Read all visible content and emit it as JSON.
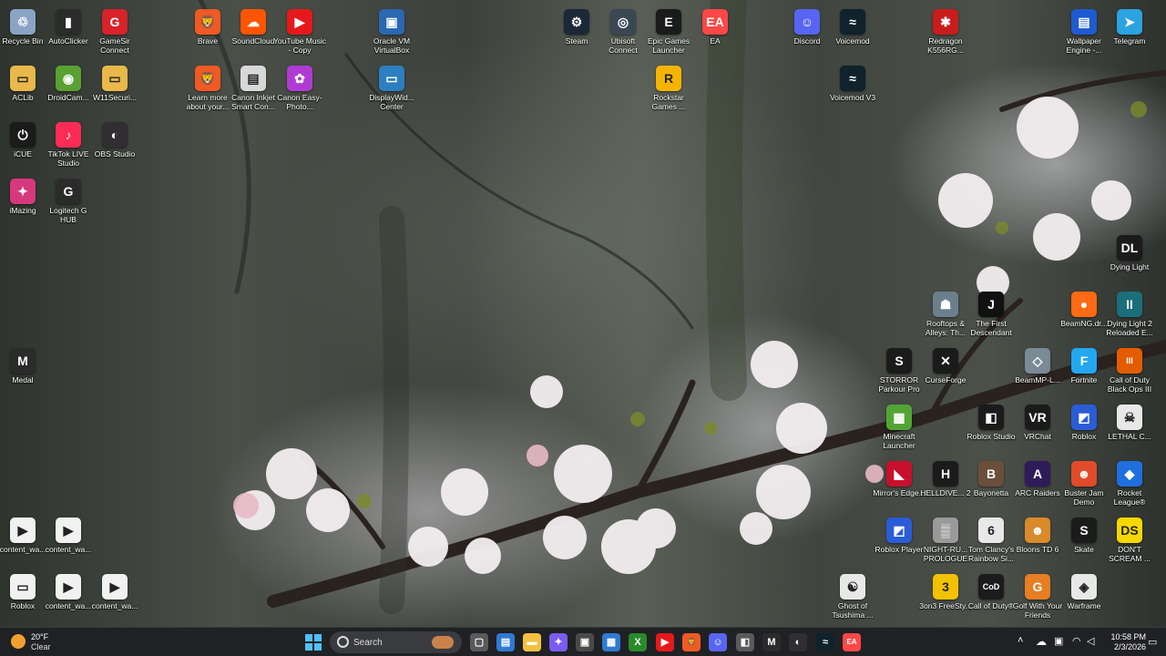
{
  "desktop_icons": [
    {
      "label": "Recycle Bin",
      "icon": "recycle-bin-icon",
      "color": "#8aa4c4",
      "glyph": "♲"
    },
    {
      "label": "AutoClicker",
      "icon": "mouse-icon",
      "color": "#2b2b2b",
      "glyph": "▮"
    },
    {
      "label": "GameSir Connect",
      "icon": "gamesir-icon",
      "color": "#d8232a",
      "glyph": "G"
    },
    {
      "label": "Brave",
      "icon": "brave-icon",
      "color": "#f05a24",
      "glyph": "🦁"
    },
    {
      "label": "SoundCloud",
      "icon": "soundcloud-icon",
      "color": "#ff5500",
      "glyph": "☁"
    },
    {
      "label": "YouTube Music - Copy",
      "icon": "youtube-music-icon",
      "color": "#e5191c",
      "glyph": "▶"
    },
    {
      "label": "Oracle VM VirtualBox",
      "icon": "virtualbox-icon",
      "color": "#2b68b1",
      "glyph": "▣"
    },
    {
      "label": "Steam",
      "icon": "steam-icon",
      "color": "#1b2838",
      "glyph": "⚙"
    },
    {
      "label": "Ubisoft Connect",
      "icon": "ubisoft-icon",
      "color": "#3b4754",
      "glyph": "◎"
    },
    {
      "label": "Epic Games Launcher",
      "icon": "epic-games-icon",
      "color": "#1b1b1b",
      "glyph": "E"
    },
    {
      "label": "EA",
      "icon": "ea-icon",
      "color": "#ff4747",
      "glyph": "EA"
    },
    {
      "label": "Discord",
      "icon": "discord-icon",
      "color": "#5865f2",
      "glyph": "☺"
    },
    {
      "label": "Voicemod",
      "icon": "voicemod-icon",
      "color": "#10222b",
      "glyph": "≈"
    },
    {
      "label": "Redragon K556RG...",
      "icon": "redragon-icon",
      "color": "#c91c1c",
      "glyph": "✱"
    },
    {
      "label": "Wallpaper Engine -...",
      "icon": "wallpaper-engine-icon",
      "color": "#1e5bd1",
      "glyph": "▤"
    },
    {
      "label": "Telegram",
      "icon": "telegram-icon",
      "color": "#2aa3e0",
      "glyph": "➤"
    },
    {
      "label": "ACLib",
      "icon": "folder-icon",
      "color": "#e8b84a",
      "glyph": "▭"
    },
    {
      "label": "DroidCam...",
      "icon": "droidcam-icon",
      "color": "#5aa133",
      "glyph": "◉"
    },
    {
      "label": "W11Securi...",
      "icon": "folder-icon",
      "color": "#e8b84a",
      "glyph": "▭"
    },
    {
      "label": "Learn more about your...",
      "icon": "brave-learn-icon",
      "color": "#f05a24",
      "glyph": "🦁"
    },
    {
      "label": "Canon Inkjet Smart Con...",
      "icon": "canon-printer-icon",
      "color": "#d8d8d8",
      "glyph": "▤"
    },
    {
      "label": "Canon Easy-Photo...",
      "icon": "canon-photo-icon",
      "color": "#b03bd3",
      "glyph": "✿"
    },
    {
      "label": "DisplayWid... Center",
      "icon": "displaywidget-icon",
      "color": "#2d7fc1",
      "glyph": "▭"
    },
    {
      "label": "Rockstar Games ...",
      "icon": "rockstar-icon",
      "color": "#f4b400",
      "glyph": "R"
    },
    {
      "label": "Voicemod V3",
      "icon": "voicemod-icon",
      "color": "#10222b",
      "glyph": "≈"
    },
    {
      "label": "iCUE",
      "icon": "icue-icon",
      "color": "#1b1b1b",
      "glyph": "⏻"
    },
    {
      "label": "TikTok LIVE Studio",
      "icon": "tiktok-icon",
      "color": "#fe2c55",
      "glyph": "♪"
    },
    {
      "label": "OBS Studio",
      "icon": "obs-icon",
      "color": "#302e31",
      "glyph": "◐"
    },
    {
      "label": "iMazing",
      "icon": "imazing-icon",
      "color": "#d6387d",
      "glyph": "✦"
    },
    {
      "label": "Logitech G HUB",
      "icon": "logitech-icon",
      "color": "#2b2b2b",
      "glyph": "G"
    },
    {
      "label": "Dying Light",
      "icon": "dying-light-icon",
      "color": "#1b1b1b",
      "glyph": "DL"
    },
    {
      "label": "Rooftops & Alleys: Th...",
      "icon": "rooftops-icon",
      "color": "#6b7f8c",
      "glyph": "☗"
    },
    {
      "label": "The First Descendant",
      "icon": "first-descendant-icon",
      "color": "#111111",
      "glyph": "J"
    },
    {
      "label": "BeamNG.dr...",
      "icon": "beamng-icon",
      "color": "#ff6a13",
      "glyph": "●"
    },
    {
      "label": "Dying Light 2 Reloaded E...",
      "icon": "dying-light-2-icon",
      "color": "#1a6f7a",
      "glyph": "II"
    },
    {
      "label": "Medal",
      "icon": "medal-icon",
      "color": "#2b2b2b",
      "glyph": "M"
    },
    {
      "label": "STORROR Parkour Pro",
      "icon": "storror-icon",
      "color": "#1b1b1b",
      "glyph": "S"
    },
    {
      "label": "CurseForge",
      "icon": "curseforge-icon",
      "color": "#1b1b1b",
      "glyph": "✕"
    },
    {
      "label": "BeamMP-L...",
      "icon": "beammp-icon",
      "color": "#7a8a96",
      "glyph": "◇"
    },
    {
      "label": "Fortnite",
      "icon": "fortnite-icon",
      "color": "#22a7f0",
      "glyph": "F"
    },
    {
      "label": "Call of Duty Black Ops III",
      "icon": "bo3-icon",
      "color": "#e35d00",
      "glyph": "III"
    },
    {
      "label": "Minecraft Launcher",
      "icon": "minecraft-icon",
      "color": "#52a535",
      "glyph": "▦"
    },
    {
      "label": "Roblox Studio",
      "icon": "roblox-studio-icon",
      "color": "#1b1b1b",
      "glyph": "◧"
    },
    {
      "label": "VRChat",
      "icon": "vrchat-icon",
      "color": "#1b1b1b",
      "glyph": "VR"
    },
    {
      "label": "Roblox",
      "icon": "roblox-icon",
      "color": "#2a5cd6",
      "glyph": "◩"
    },
    {
      "label": "LETHAL C...",
      "icon": "lethal-company-icon",
      "color": "#e8e8e8",
      "glyph": "☠"
    },
    {
      "label": "Mirror's Edge...",
      "icon": "mirrors-edge-icon",
      "color": "#c8102e",
      "glyph": "◣"
    },
    {
      "label": "HELLDIVE... 2",
      "icon": "helldivers-icon",
      "color": "#1b1b1b",
      "glyph": "H"
    },
    {
      "label": "Bayonetta",
      "icon": "bayonetta-icon",
      "color": "#6b4f3a",
      "glyph": "B"
    },
    {
      "label": "ARC Raiders",
      "icon": "arc-raiders-icon",
      "color": "#2e1b5a",
      "glyph": "A"
    },
    {
      "label": "Buster Jam Demo",
      "icon": "buster-jam-icon",
      "color": "#e14b2a",
      "glyph": "☻"
    },
    {
      "label": "Rocket League®",
      "icon": "rocket-league-icon",
      "color": "#1f6fe0",
      "glyph": "◆"
    },
    {
      "label": "content_wa...",
      "icon": "media-file-icon",
      "color": "#f1f1f1",
      "glyph": "▶"
    },
    {
      "label": "content_wa...",
      "icon": "media-file-icon",
      "color": "#f1f1f1",
      "glyph": "▶"
    },
    {
      "label": "Roblox Player",
      "icon": "roblox-player-icon",
      "color": "#2a5cd6",
      "glyph": "◩"
    },
    {
      "label": "NIGHT-RU... PROLOGUE",
      "icon": "night-runners-icon",
      "color": "#9a9a9a",
      "glyph": "▒"
    },
    {
      "label": "Tom Clancy's Rainbow Si...",
      "icon": "rainbow-six-icon",
      "color": "#e8e8e8",
      "glyph": "6"
    },
    {
      "label": "Bloons TD 6",
      "icon": "bloons-icon",
      "color": "#d98a2b",
      "glyph": "☻"
    },
    {
      "label": "Skate",
      "icon": "skate-icon",
      "color": "#1b1b1b",
      "glyph": "S"
    },
    {
      "label": "DON'T SCREAM ...",
      "icon": "dont-scream-icon",
      "color": "#f5d800",
      "glyph": "DS"
    },
    {
      "label": "Roblox",
      "icon": "roblox-file-icon",
      "color": "#f1f1f1",
      "glyph": "▭"
    },
    {
      "label": "content_wa...",
      "icon": "media-file-icon",
      "color": "#f1f1f1",
      "glyph": "▶"
    },
    {
      "label": "content_wa...",
      "icon": "media-file-icon",
      "color": "#f1f1f1",
      "glyph": "▶"
    },
    {
      "label": "Ghost of Tsushima ...",
      "icon": "ghost-of-tsushima-icon",
      "color": "#e8e8e8",
      "glyph": "☯"
    },
    {
      "label": "3on3 FreeSty...",
      "icon": "3on3-icon",
      "color": "#f2c200",
      "glyph": "3"
    },
    {
      "label": "Call of Duty®",
      "icon": "call-of-duty-icon",
      "color": "#1b1b1b",
      "glyph": "CoD"
    },
    {
      "label": "Golf With Your Friends",
      "icon": "golf-icon",
      "color": "#e67e22",
      "glyph": "G"
    },
    {
      "label": "Warframe",
      "icon": "warframe-icon",
      "color": "#e8e8e8",
      "glyph": "◈"
    }
  ],
  "taskbar": {
    "weather": {
      "temp": "20°F",
      "condition": "Clear",
      "icon": "weather-moon-icon"
    },
    "start_icon": "windows-start-icon",
    "search_placeholder": "Search",
    "apps": [
      {
        "name": "task-view",
        "icon": "task-view-icon",
        "color": "#5a5a5a",
        "glyph": "▢"
      },
      {
        "name": "widgets",
        "icon": "widgets-icon",
        "color": "#2f7bd1",
        "glyph": "▤"
      },
      {
        "name": "file-explorer",
        "icon": "file-explorer-icon",
        "color": "#f3c141",
        "glyph": "▬"
      },
      {
        "name": "copilot",
        "icon": "copilot-icon",
        "color": "#7a5cf0",
        "glyph": "✦"
      },
      {
        "name": "capture",
        "icon": "snipping-icon",
        "color": "#4a4a4a",
        "glyph": "▣"
      },
      {
        "name": "store",
        "icon": "store-icon",
        "color": "#2f7bd1",
        "glyph": "▦"
      },
      {
        "name": "xbox",
        "icon": "xbox-icon",
        "color": "#2a8a2a",
        "glyph": "X"
      },
      {
        "name": "youtube-music",
        "icon": "youtube-music-icon",
        "color": "#e5191c",
        "glyph": "▶"
      },
      {
        "name": "brave",
        "icon": "brave-icon",
        "color": "#f05a24",
        "glyph": "🦁"
      },
      {
        "name": "discord",
        "icon": "discord-icon",
        "color": "#5865f2",
        "glyph": "☺"
      },
      {
        "name": "roblox-studio",
        "icon": "roblox-studio-icon",
        "color": "#5a5a5a",
        "glyph": "◧"
      },
      {
        "name": "medal",
        "icon": "medal-icon",
        "color": "#2b2b2b",
        "glyph": "M"
      },
      {
        "name": "obs",
        "icon": "obs-icon",
        "color": "#302e31",
        "glyph": "◐"
      },
      {
        "name": "voicemod",
        "icon": "voicemod-icon",
        "color": "#10222b",
        "glyph": "≈"
      },
      {
        "name": "ea",
        "icon": "ea-icon",
        "color": "#ff4747",
        "glyph": "EA"
      }
    ],
    "clock": {
      "time": "10:58 PM",
      "date": "2/3/2026"
    }
  }
}
